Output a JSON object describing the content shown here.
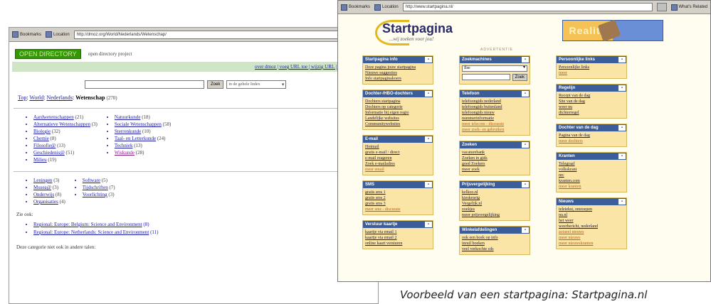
{
  "left_window": {
    "nav": {
      "back_label": "Bookmarks",
      "location_label": "Location",
      "url": "http://dmoz.org/World/Nederlands/Wetenschap/"
    },
    "logo": "OPEN DIRECTORY",
    "tagline": "open directory project",
    "top_links": "over dmoz | voeg URL toe | wijzig URL | word redacteur",
    "search_button": "Zoek",
    "search_scope": "in de gehele Index",
    "breadcrumbs": {
      "top": "Top",
      "world": "World",
      "nl": "Nederlands",
      "current": "Wetenschap",
      "count": "(270)"
    },
    "cat_col1": [
      {
        "name": "Aardwetenschappen",
        "n": "(21)"
      },
      {
        "name": "Alternatieve Wetenschappen",
        "n": "(3)"
      },
      {
        "name": "Biologie",
        "n": "(32)"
      },
      {
        "name": "Chemie",
        "n": "(8)"
      },
      {
        "name": "Filosofie@",
        "n": "(13)"
      },
      {
        "name": "Geschiedenis@",
        "n": "(51)"
      },
      {
        "name": "Milieu",
        "n": "(19)"
      }
    ],
    "cat_col2": [
      {
        "name": "Natuurkunde",
        "n": "(18)"
      },
      {
        "name": "Sociale Wetenschappen",
        "n": "(58)"
      },
      {
        "name": "Sterrenkunde",
        "n": "(10)"
      },
      {
        "name": "Taal- en Letterkunde",
        "n": "(24)"
      },
      {
        "name": "Techniek",
        "n": "(13)"
      },
      {
        "name": "Wiskunde",
        "n": "(28)"
      }
    ],
    "sub_col1": [
      {
        "name": "Leningen",
        "n": "(3)"
      },
      {
        "name": "Musea@",
        "n": "(3)"
      },
      {
        "name": "Onderwijs",
        "n": "(8)"
      },
      {
        "name": "Organisaties",
        "n": "(4)"
      }
    ],
    "sub_col2": [
      {
        "name": "Software",
        "n": "(5)"
      },
      {
        "name": "Tijdschriften",
        "n": "(7)"
      },
      {
        "name": "Voorlichting",
        "n": "(3)"
      }
    ],
    "see_also": "Zie ook:",
    "regional": [
      {
        "name": "Regional: Europe: Belgium: Science and Environment",
        "n": "(8)"
      },
      {
        "name": "Regional: Europe: Netherlands: Science and Environment",
        "n": "(11)"
      }
    ],
    "footer": "Deze categorie niet ook in andere talen:",
    "edge_letter": "Q"
  },
  "right_window": {
    "nav": {
      "back_label": "Bookmarks",
      "location_label": "Location",
      "url": "http://www.startpagina.nl/",
      "right_label": "What's Related"
    },
    "title": "Startpagina",
    "subtitle": "...wij zoeken voor jou!",
    "banner_text": "Reality",
    "divider": "ADVERTENTIE",
    "col1": [
      {
        "title": "Startpagina info",
        "items": [
          "Deze pagina jouw startpagina",
          "Nieuwe suggesties",
          "Info startpaginakoers"
        ],
        "red": []
      },
      {
        "title": "Dochter-/HBO-dochters",
        "items": [
          "Dochters startpagina",
          "Dochters op categorie",
          "Informatie bij eigen regio",
          "Landelijke websites",
          "Communitywebsites"
        ],
        "red": []
      },
      {
        "title": "E-mail",
        "items": [
          "Hotmail",
          "gratis e-mail / direct",
          "e-mail reageren",
          "Zoek e-mailadres"
        ],
        "red": [
          "meer email"
        ]
      },
      {
        "title": "SMS",
        "items": [
          "gratis sms 1",
          "gratis sms 2",
          "gratis sms 3"
        ],
        "red": [
          "meer sms - discussie"
        ]
      },
      {
        "title": "Verstuur kaartje",
        "items": [
          "kaartje via email 1",
          "kaartje via email 2",
          "online kaart versturen"
        ],
        "red": []
      }
    ],
    "col2": [
      {
        "title": "Zoekmachines",
        "select": "Ilse",
        "button": "Zoek",
        "items": [],
        "red": []
      },
      {
        "title": "Telefoon",
        "items": [
          "telefoongids nederland",
          "telefoongids buitenland",
          "telefoongids nieuw",
          "nummerinformatie"
        ],
        "red": [
          "meer telecom - discussie",
          "meer zoek- en gebruiken"
        ]
      },
      {
        "title": "Zoeken",
        "items": [
          "vacaturebank",
          "Zoeken in gids",
          "goed Zoekers",
          "meer zoek"
        ],
        "red": []
      },
      {
        "title": "Prijsvergelijking",
        "items": [
          "kelkoo.nl",
          "kieskeurig",
          "Vergelijk.nl",
          "zoekjes",
          "meer prijsvergelijking"
        ],
        "red": []
      },
      {
        "title": "Winkelafdelingen",
        "items": [
          "ook een boek op info",
          "inruil boeken",
          "veel verkochte cds"
        ],
        "red": []
      }
    ],
    "col3": [
      {
        "title": "Persoonlijke links",
        "items": [
          "Persoonlijke links"
        ],
        "red": [
          "meer"
        ]
      },
      {
        "title": "Regelijn",
        "items": [
          "Recept van de dag",
          "Site van de dag",
          "weer nu",
          "dichterregel"
        ],
        "red": []
      },
      {
        "title": "Dochter van de dag",
        "items": [
          "Pagina van de dag"
        ],
        "red": [
          "meer dochters"
        ]
      },
      {
        "title": "Kranten",
        "items": [
          "Telegraaf",
          "volkskrant",
          "nrc",
          "kranten.com"
        ],
        "red": [
          "meer kranten"
        ]
      },
      {
        "title": "Nieuws",
        "items": [
          "teletekst, omroepen",
          "nu.nl",
          "het weer",
          "weerbericht, nederland"
        ],
        "red": [
          "actueel nieuws",
          "meer nieuws",
          "meer nieuwskranten"
        ]
      }
    ]
  },
  "caption": "Voorbeeld van een startpagina: Startpagina.nl"
}
